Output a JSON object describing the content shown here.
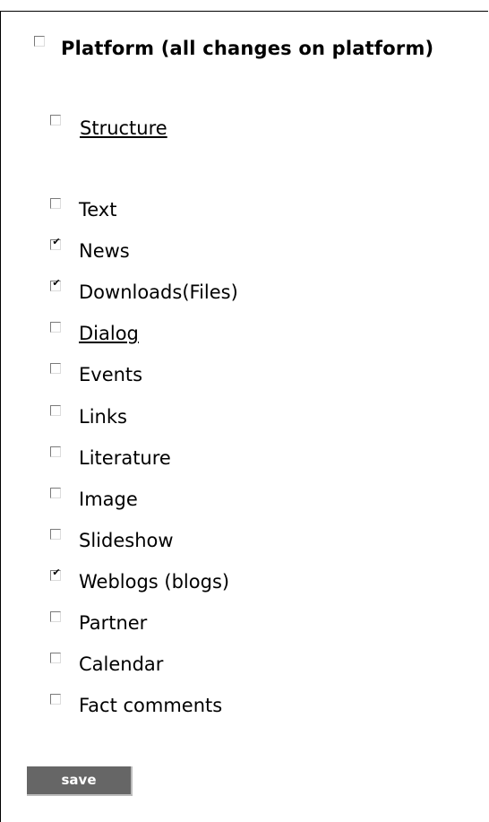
{
  "platform": {
    "label": "Platform (all changes on platform)",
    "checked": false
  },
  "structure": {
    "label": "Structure",
    "checked": false
  },
  "items": [
    {
      "label": "Text",
      "checked": false,
      "link": false
    },
    {
      "label": "News",
      "checked": true,
      "link": false
    },
    {
      "label": "Downloads(Files)",
      "checked": true,
      "link": false
    },
    {
      "label": "Dialog",
      "checked": false,
      "link": true
    },
    {
      "label": "Events",
      "checked": false,
      "link": false
    },
    {
      "label": "Links",
      "checked": false,
      "link": false
    },
    {
      "label": "Literature",
      "checked": false,
      "link": false
    },
    {
      "label": "Image",
      "checked": false,
      "link": false
    },
    {
      "label": "Slideshow",
      "checked": false,
      "link": false
    },
    {
      "label": "Weblogs (blogs)",
      "checked": true,
      "link": false
    },
    {
      "label": "Partner",
      "checked": false,
      "link": false
    },
    {
      "label": "Calendar",
      "checked": false,
      "link": false
    },
    {
      "label": "Fact comments",
      "checked": false,
      "link": false
    }
  ],
  "save_label": "save",
  "check_glyph": "✔"
}
